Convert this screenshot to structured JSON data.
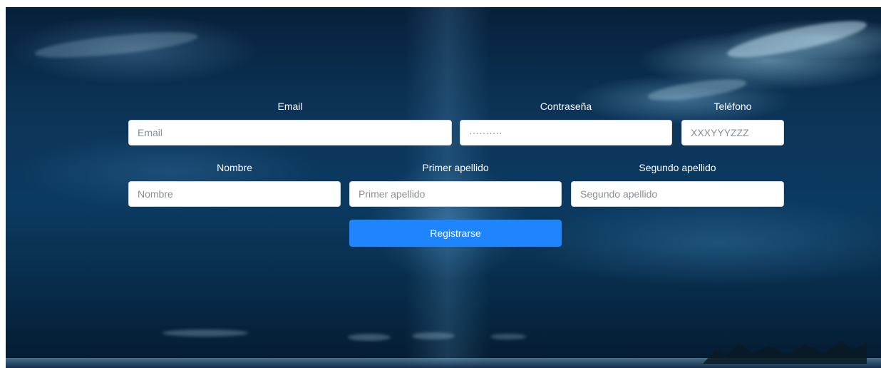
{
  "form": {
    "email": {
      "label": "Email",
      "placeholder": "Email"
    },
    "password": {
      "label": "Contraseña",
      "placeholder": "··········"
    },
    "phone": {
      "label": "Teléfono",
      "placeholder": "XXXYYYZZZ"
    },
    "first_name": {
      "label": "Nombre",
      "placeholder": "Nombre"
    },
    "last_name_1": {
      "label": "Primer apellido",
      "placeholder": "Primer apellido"
    },
    "last_name_2": {
      "label": "Segundo apellido",
      "placeholder": "Segundo apellido"
    },
    "submit_label": "Registrarse"
  },
  "colors": {
    "button": "#1e85ff",
    "label_text": "#ffffff",
    "background": "#0b3a60"
  }
}
